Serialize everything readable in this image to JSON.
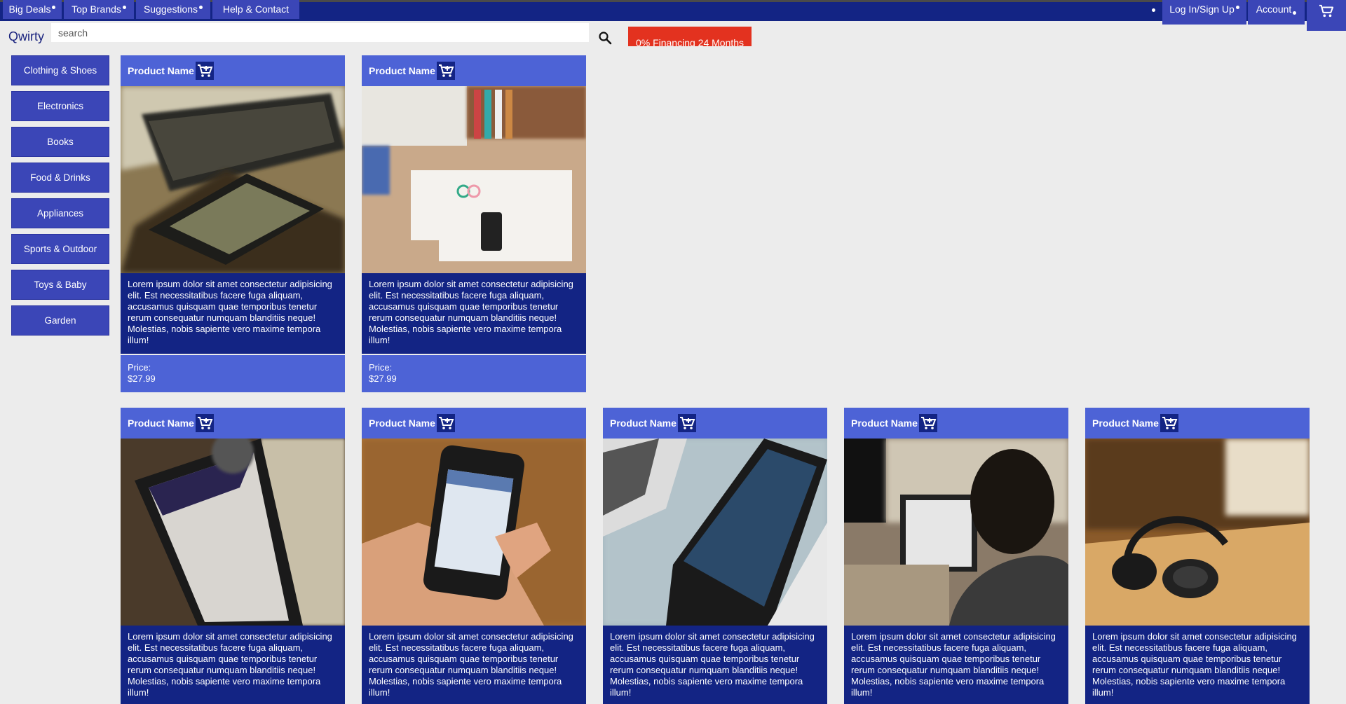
{
  "nav": {
    "left_tabs": [
      "Big Deals",
      "Top Brands",
      "Suggestions",
      "Help & Contact"
    ],
    "login": "Log In/Sign Up",
    "account": "Account"
  },
  "brand": "Qwirty",
  "search": {
    "placeholder": "search"
  },
  "promo": "0% Financing 24 Months",
  "categories": [
    "Clothing & Shoes",
    "Electronics",
    "Books",
    "Food & Drinks",
    "Appliances",
    "Sports & Outdoor",
    "Toys & Baby",
    "Garden"
  ],
  "products": [
    {
      "name": "Product Name",
      "description": "Lorem ipsum dolor sit amet consectetur adipisicing elit. Est necessitatibus facere fuga aliquam, accusamus quisquam quae temporibus tenetur rerum consequatur numquam blanditiis neque! Molestias, nobis sapiente vero maxime tempora illum!",
      "price_label": "Price:",
      "price": "$27.99",
      "image": "laptop-and-smartphone-photo"
    },
    {
      "name": "Product Name",
      "description": "Lorem ipsum dolor sit amet consectetur adipisicing elit. Est necessitatibus facere fuga aliquam, accusamus quisquam quae temporibus tenetur rerum consequatur numquam blanditiis neque! Molestias, nobis sapiente vero maxime tempora illum!",
      "price_label": "Price:",
      "price": "$27.99",
      "image": "desk-flatlay-photo"
    },
    {
      "name": "Product Name",
      "description": "Lorem ipsum dolor sit amet consectetur adipisicing elit. Est necessitatibus facere fuga aliquam, accusamus quisquam quae temporibus tenetur rerum consequatur numquam blanditiis neque! Molestias, nobis sapiente vero maxime tempora illum!",
      "image": "tablet-ebook-photo"
    },
    {
      "name": "Product Name",
      "description": "Lorem ipsum dolor sit amet consectetur adipisicing elit. Est necessitatibus facere fuga aliquam, accusamus quisquam quae temporibus tenetur rerum consequatur numquam blanditiis neque! Molestias, nobis sapiente vero maxime tempora illum!",
      "image": "phone-in-hand-photo"
    },
    {
      "name": "Product Name",
      "description": "Lorem ipsum dolor sit amet consectetur adipisicing elit. Est necessitatibus facere fuga aliquam, accusamus quisquam quae temporibus tenetur rerum consequatur numquam blanditiis neque! Molestias, nobis sapiente vero maxime tempora illum!",
      "image": "laptop-screen-photo"
    },
    {
      "name": "Product Name",
      "description": "Lorem ipsum dolor sit amet consectetur adipisicing elit. Est necessitatibus facere fuga aliquam, accusamus quisquam quae temporibus tenetur rerum consequatur numquam blanditiis neque! Molestias, nobis sapiente vero maxime tempora illum!",
      "image": "person-at-computer-photo"
    },
    {
      "name": "Product Name",
      "description": "Lorem ipsum dolor sit amet consectetur adipisicing elit. Est necessitatibus facere fuga aliquam, accusamus quisquam quae temporibus tenetur rerum consequatur numquam blanditiis neque! Molestias, nobis sapiente vero maxime tempora illum!",
      "image": "headphones-photo"
    }
  ],
  "colors": {
    "nav_bar": "#132484",
    "nav_tab": "#3b46b7",
    "card_header": "#4d63d6",
    "card_body": "#132484",
    "promo": "#e3321f",
    "background": "#ececec"
  }
}
